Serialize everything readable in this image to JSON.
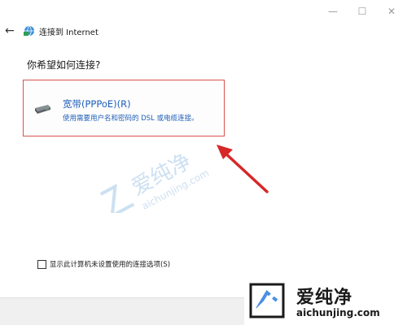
{
  "window": {
    "minimize_glyph": "—",
    "maximize_glyph": "☐",
    "close_glyph": "✕"
  },
  "header": {
    "back_glyph": "←",
    "title": "连接到 Internet",
    "icon": "network-globe-icon"
  },
  "question": "你希望如何连接?",
  "option": {
    "icon": "modem-icon",
    "title": "宽带(PPPoE)(R)",
    "description": "使用需要用户名和密码的 DSL 或电缆连接。"
  },
  "checkbox": {
    "checked": false,
    "label": "显示此计算机未设置使用的连接选项(S)"
  },
  "logo": {
    "cn": "爱纯净",
    "en": "aichunjing.com"
  },
  "colors": {
    "highlight_border": "#d9534f",
    "link_blue": "#1f5fb8",
    "arrow_red": "#d62828"
  }
}
